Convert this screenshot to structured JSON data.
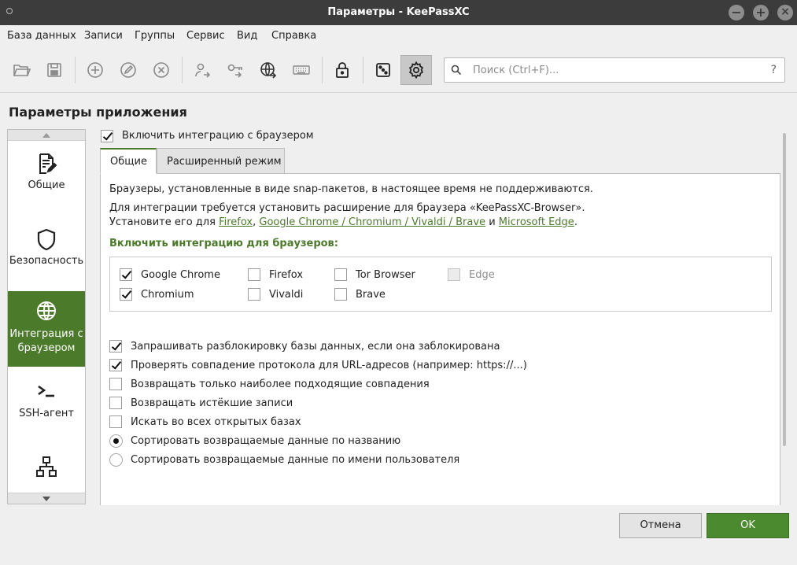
{
  "window": {
    "title": "Параметры - KeePassXC"
  },
  "menu": [
    "База данных",
    "Записи",
    "Группы",
    "Сервис",
    "Вид",
    "Справка"
  ],
  "toolbar": {
    "icons": [
      "folder-open-icon",
      "save-icon",
      "add-entry-icon",
      "edit-entry-icon",
      "delete-entry-icon",
      "user-transfer-icon",
      "key-transfer-icon",
      "globe-icon",
      "keyboard-icon",
      "lock-icon",
      "dice-icon",
      "settings-icon"
    ],
    "search_placeholder": "Поиск (Ctrl+F)...",
    "search_help": "?"
  },
  "page": {
    "title": "Параметры приложения"
  },
  "sidebar": {
    "items": [
      {
        "label": "Общие",
        "icon": "document-edit-icon"
      },
      {
        "label": "Безопасность",
        "icon": "shield-icon"
      },
      {
        "label": "Интеграция с браузером",
        "icon": "globe-icon",
        "active": true
      },
      {
        "label": "SSH-агент",
        "icon": "terminal-icon"
      },
      {
        "label": "",
        "icon": "network-icon"
      }
    ]
  },
  "browser": {
    "enable_label": "Включить интеграцию с браузером",
    "enable_checked": true,
    "tabs": [
      "Общие",
      "Расширенный режим"
    ],
    "snap_note": "Браузеры, установленные в виде snap-пакетов, в настоящее время не поддерживаются.",
    "requires_text": "Для интеграции требуется установить расширение для браузера «KeePassXC-Browser».",
    "install_prefix": "Установите его для",
    "install_link1": "Firefox",
    "install_sep": ",",
    "install_link2": "Google Chrome / Chromium / Vivaldi / Brave",
    "install_and": "и",
    "install_link3": "Microsoft Edge",
    "install_end": ".",
    "group_title": "Включить интеграцию для браузеров:",
    "browsers": {
      "google_chrome": {
        "label": "Google Chrome",
        "checked": true
      },
      "firefox": {
        "label": "Firefox",
        "checked": false
      },
      "tor_browser": {
        "label": "Tor Browser",
        "checked": false
      },
      "edge": {
        "label": "Edge",
        "checked": false,
        "disabled": true
      },
      "chromium": {
        "label": "Chromium",
        "checked": true
      },
      "vivaldi": {
        "label": "Vivaldi",
        "checked": false
      },
      "brave": {
        "label": "Brave",
        "checked": false
      }
    },
    "options": [
      {
        "label": "Запрашивать разблокировку базы данных, если она заблокирована",
        "type": "checkbox",
        "checked": true
      },
      {
        "label": "Проверять совпадение протокола для URL-адресов (например: https://...)",
        "type": "checkbox",
        "checked": true
      },
      {
        "label": "Возвращать только наиболее подходящие совпадения",
        "type": "checkbox",
        "checked": false
      },
      {
        "label": "Возвращать истёкшие записи",
        "type": "checkbox",
        "checked": false
      },
      {
        "label": "Искать во всех открытых базах",
        "type": "checkbox",
        "checked": false
      },
      {
        "label": "Сортировать возвращаемые данные по названию",
        "type": "radio",
        "checked": true
      },
      {
        "label": "Сортировать возвращаемые данные по имени пользователя",
        "type": "radio",
        "checked": false
      }
    ]
  },
  "buttons": {
    "cancel": "Отмена",
    "ok": "OK"
  },
  "colors": {
    "accent": "#4b7a2b",
    "titlebar": "#3c3c3c"
  }
}
